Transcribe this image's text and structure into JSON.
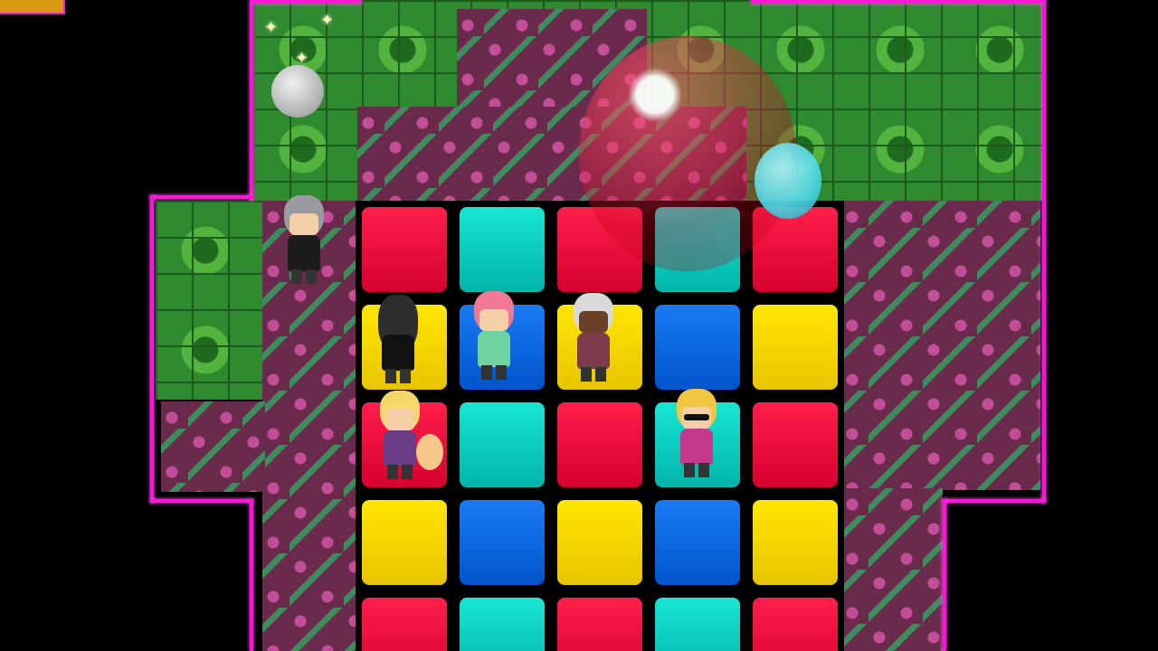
{
  "scene": {
    "grid": {
      "columns": 5,
      "rows": [
        [
          "red",
          "cyan",
          "red",
          "cyan",
          "red"
        ],
        [
          "yellow",
          "blue",
          "yellow",
          "blue",
          "yellow"
        ],
        [
          "red",
          "cyan",
          "red",
          "cyan",
          "red"
        ],
        [
          "yellow",
          "blue",
          "yellow",
          "blue",
          "yellow"
        ],
        [
          "red",
          "cyan",
          "red",
          "cyan",
          "red"
        ]
      ]
    },
    "colors": {
      "neon_border": "#ff14d8",
      "floor": "#6a2a4c",
      "machinery": "#2f8a2f",
      "red_tile": "#ff1f4a",
      "cyan_tile": "#19e6d6",
      "yellow_tile": "#ffe600",
      "blue_tile": "#1a7bf0"
    },
    "characters": [
      {
        "name": "gray-haired-glasses-character",
        "hair": "#9a9aa0",
        "outfit": "#1c1c1c"
      },
      {
        "name": "long-black-hair-character",
        "hair": "#2e2e2e",
        "outfit": "#111111"
      },
      {
        "name": "pink-hair-headband-character",
        "hair": "#f07a96",
        "outfit": "#6fd3a0"
      },
      {
        "name": "dark-skin-white-hair-character",
        "hair": "#d9d9d9",
        "outfit": "#7a3b4a"
      },
      {
        "name": "blonde-fox-tail-character",
        "hair": "#f6d86a",
        "outfit": "#6b3c86"
      },
      {
        "name": "spiky-blonde-sunglasses-character",
        "hair": "#f2c640",
        "outfit": "#c4388f"
      }
    ],
    "objects": [
      "red-bubble",
      "cyan-orb",
      "gray-orb"
    ]
  }
}
